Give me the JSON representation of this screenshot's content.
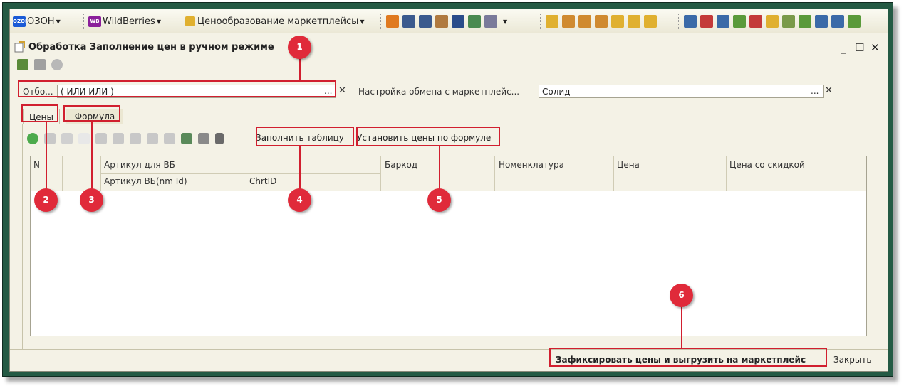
{
  "toolbar": {
    "ozon_logo_text": "OZON",
    "ozon_label": "ОЗОН",
    "wb_logo_text": "WB",
    "wb_label": "WildBerries",
    "pricing_label": "Ценообразование маркетплейсы"
  },
  "window": {
    "title": "Обработка  Заполнение цен в ручном режиме"
  },
  "filter": {
    "label": "Отбо...",
    "value": "( ИЛИ ИЛИ )",
    "dots": "...",
    "clear": "✕"
  },
  "exchange": {
    "label": "Настройка обмена с маркетплейс...",
    "value": "Солид",
    "dots": "...",
    "clear": "✕"
  },
  "tabs": {
    "prices": "Цены",
    "formula": "Формула"
  },
  "commands": {
    "fill_table": "Заполнить таблицу",
    "set_prices_formula": "Установить цены по формуле"
  },
  "table": {
    "columns": {
      "n": "N",
      "article_wb": "Артикул для ВБ",
      "article_nmid": "Артикул ВБ(nm Id)",
      "chrtid": "ChrtID",
      "barcode": "Баркод",
      "nomenclature": "Номенклатура",
      "price": "Цена",
      "price_discount": "Цена со скидкой"
    },
    "rows": []
  },
  "footer": {
    "commit_button": "Зафиксировать цены и выгрузить на маркетплейс",
    "close_button": "Закрыть"
  },
  "callouts": [
    "1",
    "2",
    "3",
    "4",
    "5",
    "6"
  ],
  "colors": {
    "frame": "#245a44",
    "callout": "#e02a3a",
    "accent_box": "#d11f2f"
  }
}
